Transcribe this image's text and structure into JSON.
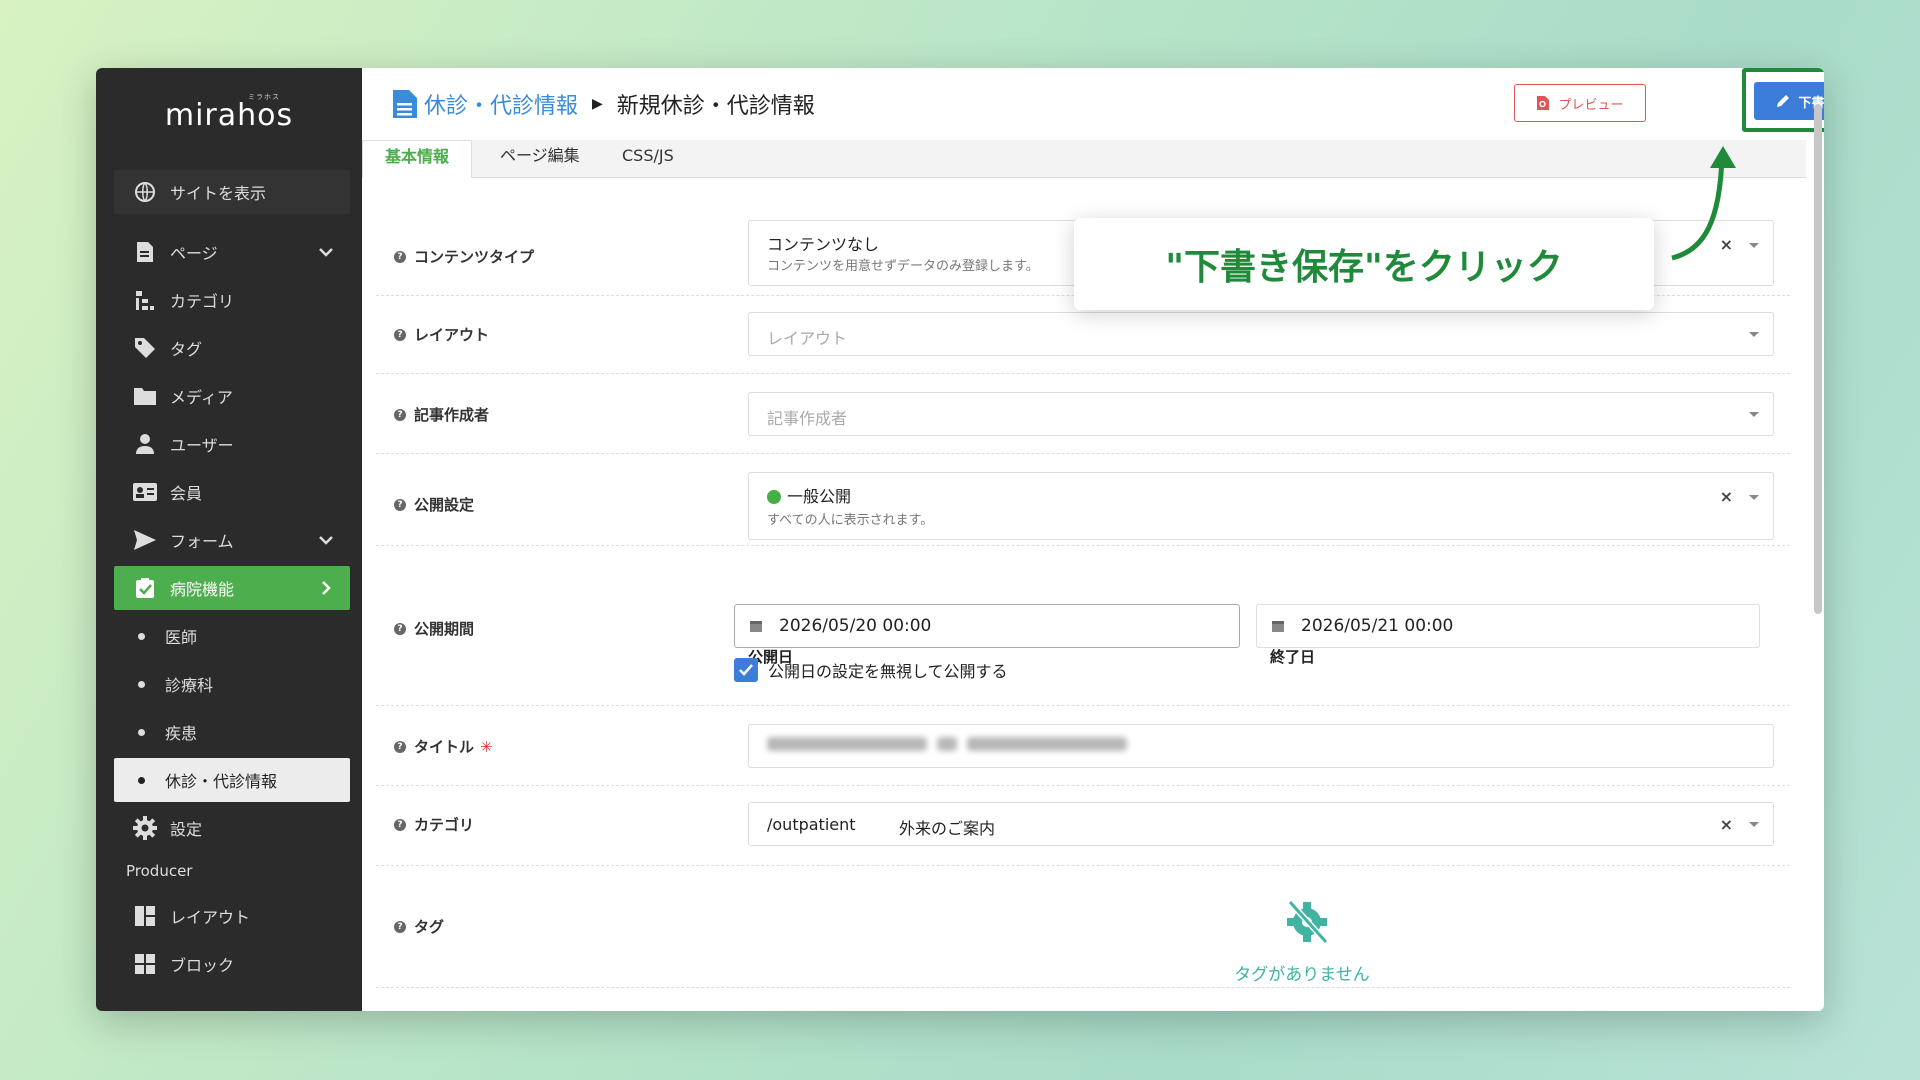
{
  "logo": {
    "text": "mirahos",
    "kana": "ミラホス"
  },
  "sidebar": {
    "site_view": "サイトを表示",
    "items": [
      {
        "label": "ページ",
        "icon": "document-icon"
      },
      {
        "label": "カテゴリ",
        "icon": "tree-icon"
      },
      {
        "label": "タグ",
        "icon": "tag-icon"
      },
      {
        "label": "メディア",
        "icon": "folder-icon"
      },
      {
        "label": "ユーザー",
        "icon": "user-icon"
      },
      {
        "label": "会員",
        "icon": "id-card-icon"
      },
      {
        "label": "フォーム",
        "icon": "send-icon"
      },
      {
        "label": "病院機能",
        "icon": "clipboard-check-icon"
      },
      {
        "label": "医師"
      },
      {
        "label": "診療科"
      },
      {
        "label": "疾患"
      },
      {
        "label": "休診・代診情報"
      },
      {
        "label": "設定",
        "icon": "gear-icon"
      },
      {
        "label": "レイアウト",
        "icon": "layout-icon"
      },
      {
        "label": "ブロック",
        "icon": "grid-icon"
      }
    ],
    "producer_heading": "Producer"
  },
  "header": {
    "breadcrumb_parent": "休診・代診情報",
    "breadcrumb_current": "新規休診・代診情報",
    "preview_label": "プレビュー",
    "save_draft_label": "下書き保存"
  },
  "tabs": [
    "基本情報",
    "ページ編集",
    "CSS/JS"
  ],
  "form": {
    "content_type": {
      "label": "コンテンツタイプ",
      "value": "コンテンツなし",
      "description": "コンテンツを用意せずデータのみ登録します。"
    },
    "layout": {
      "label": "レイアウト",
      "placeholder": "レイアウト"
    },
    "author": {
      "label": "記事作成者",
      "placeholder": "記事作成者"
    },
    "visibility": {
      "label": "公開設定",
      "value": "一般公開",
      "description": "すべての人に表示されます。"
    },
    "period": {
      "label": "公開期間",
      "start_label": "公開日",
      "start_value": "2026/05/20 00:00",
      "end_label": "終了日",
      "end_value": "2026/05/21 00:00",
      "ignore_checkbox_label": "公開日の設定を無視して公開する",
      "ignore_checked": true
    },
    "title": {
      "label": "タイトル",
      "required_mark": "✳"
    },
    "category": {
      "label": "カテゴリ",
      "slug": "/outpatient",
      "name": "外来のご案内"
    },
    "tags": {
      "label": "タグ",
      "empty_text": "タグがありません"
    }
  },
  "callout": {
    "text": "\"下書き保存\"をクリック"
  },
  "colors": {
    "accent_green": "#4cae4c",
    "highlight_green": "#1f8a3a",
    "primary_blue": "#3b7dd8",
    "danger_red": "#e05555"
  }
}
